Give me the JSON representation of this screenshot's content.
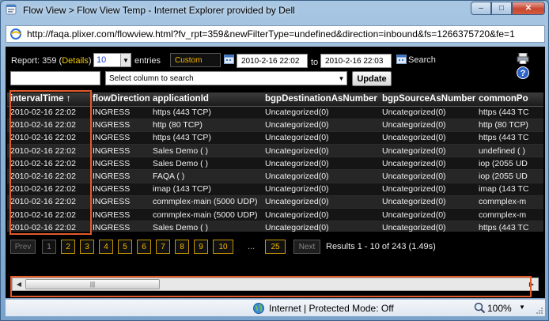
{
  "window": {
    "title": "Flow View > Flow View Temp - Internet Explorer provided by Dell",
    "url": "http://faqa.plixer.com/flowview.html?fv_rpt=359&newFilterType=undefined&direction=inbound&fs=1266375720&fe=1",
    "min_symbol": "–",
    "max_symbol": "□",
    "close_symbol": "✕"
  },
  "toolbar": {
    "report_prefix": "Report: 359 (",
    "details_label": "Details",
    "report_suffix": ")",
    "entries_value": "10",
    "entries_label": "entries",
    "range_label": "Custom",
    "start_date": "2010-2-16 22:02",
    "to_label": "to",
    "end_date": "2010-2-16 22:03",
    "search_label": "Search",
    "column_select_placeholder": "Select column to search",
    "update_label": "Update"
  },
  "table": {
    "columns": [
      "intervalTime ↑",
      "flowDirection",
      "applicationId",
      "bgpDestinationAsNumber",
      "bgpSourceAsNumber",
      "commonPo"
    ],
    "rows": [
      [
        "2010-02-16 22:02",
        "INGRESS",
        "https (443 TCP)",
        "Uncategorized(0)",
        "Uncategorized(0)",
        "https (443 TC"
      ],
      [
        "2010-02-16 22:02",
        "INGRESS",
        "http (80 TCP)",
        "Uncategorized(0)",
        "Uncategorized(0)",
        "http (80 TCP)"
      ],
      [
        "2010-02-16 22:02",
        "INGRESS",
        "https (443 TCP)",
        "Uncategorized(0)",
        "Uncategorized(0)",
        "https (443 TC"
      ],
      [
        "2010-02-16 22:02",
        "INGRESS",
        "Sales Demo ( )",
        "Uncategorized(0)",
        "Uncategorized(0)",
        "undefined ( )"
      ],
      [
        "2010-02-16 22:02",
        "INGRESS",
        "Sales Demo ( )",
        "Uncategorized(0)",
        "Uncategorized(0)",
        "iop (2055 UD"
      ],
      [
        "2010-02-16 22:02",
        "INGRESS",
        "FAQA ( )",
        "Uncategorized(0)",
        "Uncategorized(0)",
        "iop (2055 UD"
      ],
      [
        "2010-02-16 22:02",
        "INGRESS",
        "imap (143 TCP)",
        "Uncategorized(0)",
        "Uncategorized(0)",
        "imap (143 TC"
      ],
      [
        "2010-02-16 22:02",
        "INGRESS",
        "commplex-main (5000 UDP)",
        "Uncategorized(0)",
        "Uncategorized(0)",
        "commplex-m"
      ],
      [
        "2010-02-16 22:02",
        "INGRESS",
        "commplex-main (5000 UDP)",
        "Uncategorized(0)",
        "Uncategorized(0)",
        "commplex-m"
      ],
      [
        "2010-02-16 22:02",
        "INGRESS",
        "Sales Demo ( )",
        "Uncategorized(0)",
        "Uncategorized(0)",
        "https (443 TC"
      ]
    ]
  },
  "pagination": {
    "prev_label": "Prev",
    "pages": [
      "1",
      "2",
      "3",
      "4",
      "5",
      "6",
      "7",
      "8",
      "9",
      "10"
    ],
    "current_page": "1",
    "ellipsis": "...",
    "last_page": "25",
    "next_label": "Next",
    "results_text": "Results 1 - 10 of 243 (1.49s)"
  },
  "scrollbar": {
    "left_arrow": "◀",
    "right_arrow": "▶",
    "grip": "|||"
  },
  "statusbar": {
    "zone_text": "Internet | Protected Mode: Off",
    "zoom_text": "100%",
    "zoom_dropdown": "▼"
  },
  "colors": {
    "accent_orange": "#f5b800",
    "highlight_box": "#e25b2b",
    "content_bg": "#000000"
  },
  "icons": [
    "ie-app-icon",
    "ie-page-icon",
    "calendar-icon",
    "search-icon",
    "print-icon",
    "help-icon",
    "globe-icon",
    "zoom-icon",
    "resize-grip-icon"
  ]
}
